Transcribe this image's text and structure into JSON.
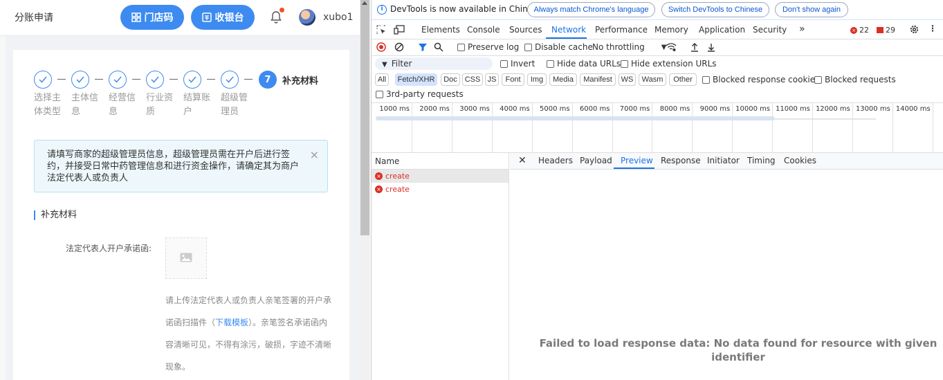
{
  "app": {
    "title": "分账申请",
    "store_code_btn": "门店码",
    "cashier_btn": "收银台",
    "username": "xubo1",
    "steps": [
      {
        "label": "选择主体类型"
      },
      {
        "label": "主体信息"
      },
      {
        "label": "经营信息"
      },
      {
        "label": "行业资质"
      },
      {
        "label": "结算账户"
      },
      {
        "label": "超级管理员"
      }
    ],
    "active_step": {
      "number": "7",
      "label": "补充材料"
    },
    "notice": "请填写商家的超级管理员信息，超级管理员需在开户后进行签约，并接受日常中药管理信息和进行资金操作，请确定其为商户法定代表人或负责人",
    "section_title": "补充材料",
    "field_label": "法定代表人开户承诺函:",
    "hint_pre": "请上传法定代表人或负责人亲笔签署的开户承诺函扫描件（",
    "hint_link": "下载模板",
    "hint_post": "）。亲笔签名承诺函内容清晰可见，不得有涂污，破损，字迹不清晰现象。"
  },
  "devtools": {
    "info_text": "DevTools is now available in Chinese!",
    "info_buttons": [
      "Always match Chrome's language",
      "Switch DevTools to Chinese",
      "Don't show again"
    ],
    "tabs": [
      "Elements",
      "Console",
      "Sources",
      "Network",
      "Performance",
      "Memory",
      "Application",
      "Security"
    ],
    "more_tabs": "»",
    "error_count": "22",
    "warning_count": "29",
    "toolbar": {
      "preserve_log": "Preserve log",
      "disable_cache": "Disable cache",
      "throttling": "No throttling"
    },
    "filter_placeholder": "Filter",
    "filter_options": [
      "Invert",
      "Hide data URLs",
      "Hide extension URLs"
    ],
    "type_filters": [
      "All",
      "Fetch/XHR",
      "Doc",
      "CSS",
      "JS",
      "Font",
      "Img",
      "Media",
      "Manifest",
      "WS",
      "Wasm",
      "Other"
    ],
    "blocked_cookies": "Blocked response cookies",
    "blocked_requests": "Blocked requests",
    "third_party": "3rd-party requests",
    "timeline_labels": [
      "1000 ms",
      "2000 ms",
      "3000 ms",
      "4000 ms",
      "5000 ms",
      "6000 ms",
      "7000 ms",
      "8000 ms",
      "9000 ms",
      "10000 ms",
      "11000 ms",
      "12000 ms",
      "13000 ms",
      "14000 ms"
    ],
    "name_header": "Name",
    "requests": [
      "create",
      "create"
    ],
    "detail_tabs": [
      "Headers",
      "Payload",
      "Preview",
      "Response",
      "Initiator",
      "Timing",
      "Cookies"
    ],
    "message": "Failed to load response data: No data found for resource with given identifier"
  },
  "colors": {
    "accent": "#3d8bf0",
    "devtools_blue": "#1a73e8",
    "error": "#d93025"
  }
}
